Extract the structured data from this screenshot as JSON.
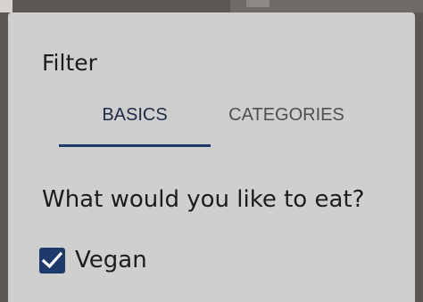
{
  "dialog": {
    "title": "Filter",
    "tabs": [
      {
        "label": "BASICS",
        "selected": true
      },
      {
        "label": "CATEGORIES",
        "selected": false
      }
    ],
    "question": "What would you like to eat?",
    "options": [
      {
        "label": "Vegan",
        "checked": true
      }
    ]
  },
  "colors": {
    "accent": "#1d3a6a",
    "dialog_bg": "#cfcfcf",
    "backdrop": "#5b5753"
  }
}
